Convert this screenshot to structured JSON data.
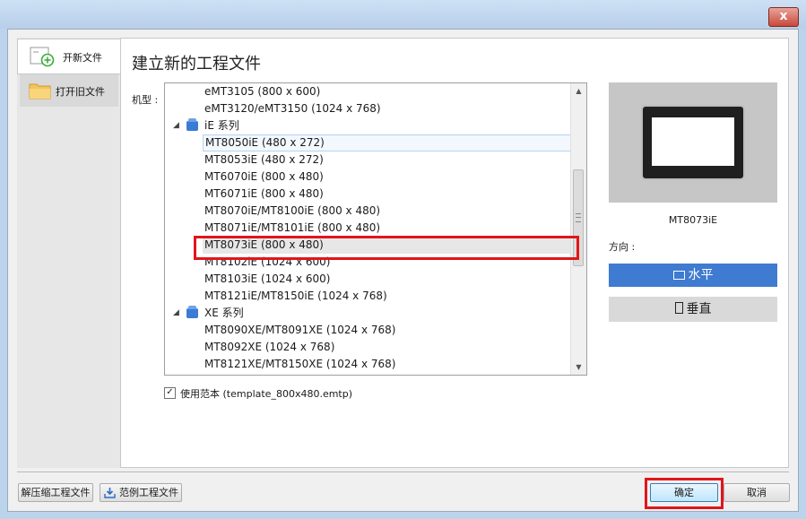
{
  "window": {
    "close_glyph": "x"
  },
  "nav": {
    "new_project": "开新文件",
    "open_project": "打开旧文件"
  },
  "page_title": "建立新的工程文件",
  "model_label": "机型 :",
  "tree": {
    "items": [
      {
        "text": "eMT3105 (800 x 600)",
        "kind": "item"
      },
      {
        "text": "eMT3120/eMT3150 (1024 x 768)",
        "kind": "item"
      },
      {
        "text": "iE 系列",
        "kind": "group"
      },
      {
        "text": "MT8050iE (480 x 272)",
        "kind": "item",
        "state": "hover"
      },
      {
        "text": "MT8053iE (480 x 272)",
        "kind": "item"
      },
      {
        "text": "MT6070iE (800 x 480)",
        "kind": "item"
      },
      {
        "text": "MT6071iE (800 x 480)",
        "kind": "item"
      },
      {
        "text": "MT8070iE/MT8100iE (800 x 480)",
        "kind": "item"
      },
      {
        "text": "MT8071iE/MT8101iE (800 x 480)",
        "kind": "item"
      },
      {
        "text": "MT8073iE (800 x 480)",
        "kind": "item",
        "state": "selected"
      },
      {
        "text": "MT8102iE (1024 x 600)",
        "kind": "item"
      },
      {
        "text": "MT8103iE (1024 x 600)",
        "kind": "item"
      },
      {
        "text": "MT8121iE/MT8150iE (1024 x 768)",
        "kind": "item"
      },
      {
        "text": "XE 系列",
        "kind": "group"
      },
      {
        "text": "MT8090XE/MT8091XE (1024 x 768)",
        "kind": "item"
      },
      {
        "text": "MT8092XE (1024 x 768)",
        "kind": "item"
      },
      {
        "text": "MT8121XE/MT8150XE (1024 x 768)",
        "kind": "item"
      }
    ]
  },
  "template_checkbox": {
    "checked": true,
    "label": "使用范本 (template_800x480.emtp)"
  },
  "preview": {
    "model_name": "MT8073iE"
  },
  "orientation": {
    "label": "方向 :",
    "horizontal": "水平",
    "vertical": "垂直",
    "selected": "horizontal"
  },
  "footer": {
    "decompress": "解压缩工程文件",
    "examples": "范例工程文件",
    "ok": "确定",
    "cancel": "取消"
  },
  "colors": {
    "accent": "#3e7bd1",
    "highlight": "#e0161b",
    "group_icon": "#3a7bd5",
    "new_icon": "#3bab3b",
    "folder_icon": "#f4c45a"
  }
}
